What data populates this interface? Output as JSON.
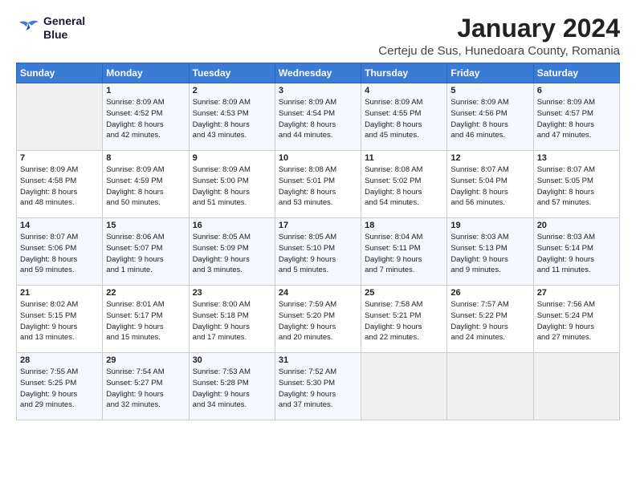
{
  "logo": {
    "line1": "General",
    "line2": "Blue"
  },
  "title": "January 2024",
  "subtitle": "Certeju de Sus, Hunedoara County, Romania",
  "weekdays": [
    "Sunday",
    "Monday",
    "Tuesday",
    "Wednesday",
    "Thursday",
    "Friday",
    "Saturday"
  ],
  "weeks": [
    [
      {
        "day": "",
        "info": ""
      },
      {
        "day": "1",
        "info": "Sunrise: 8:09 AM\nSunset: 4:52 PM\nDaylight: 8 hours\nand 42 minutes."
      },
      {
        "day": "2",
        "info": "Sunrise: 8:09 AM\nSunset: 4:53 PM\nDaylight: 8 hours\nand 43 minutes."
      },
      {
        "day": "3",
        "info": "Sunrise: 8:09 AM\nSunset: 4:54 PM\nDaylight: 8 hours\nand 44 minutes."
      },
      {
        "day": "4",
        "info": "Sunrise: 8:09 AM\nSunset: 4:55 PM\nDaylight: 8 hours\nand 45 minutes."
      },
      {
        "day": "5",
        "info": "Sunrise: 8:09 AM\nSunset: 4:56 PM\nDaylight: 8 hours\nand 46 minutes."
      },
      {
        "day": "6",
        "info": "Sunrise: 8:09 AM\nSunset: 4:57 PM\nDaylight: 8 hours\nand 47 minutes."
      }
    ],
    [
      {
        "day": "7",
        "info": "Sunrise: 8:09 AM\nSunset: 4:58 PM\nDaylight: 8 hours\nand 48 minutes."
      },
      {
        "day": "8",
        "info": "Sunrise: 8:09 AM\nSunset: 4:59 PM\nDaylight: 8 hours\nand 50 minutes."
      },
      {
        "day": "9",
        "info": "Sunrise: 8:09 AM\nSunset: 5:00 PM\nDaylight: 8 hours\nand 51 minutes."
      },
      {
        "day": "10",
        "info": "Sunrise: 8:08 AM\nSunset: 5:01 PM\nDaylight: 8 hours\nand 53 minutes."
      },
      {
        "day": "11",
        "info": "Sunrise: 8:08 AM\nSunset: 5:02 PM\nDaylight: 8 hours\nand 54 minutes."
      },
      {
        "day": "12",
        "info": "Sunrise: 8:07 AM\nSunset: 5:04 PM\nDaylight: 8 hours\nand 56 minutes."
      },
      {
        "day": "13",
        "info": "Sunrise: 8:07 AM\nSunset: 5:05 PM\nDaylight: 8 hours\nand 57 minutes."
      }
    ],
    [
      {
        "day": "14",
        "info": "Sunrise: 8:07 AM\nSunset: 5:06 PM\nDaylight: 8 hours\nand 59 minutes."
      },
      {
        "day": "15",
        "info": "Sunrise: 8:06 AM\nSunset: 5:07 PM\nDaylight: 9 hours\nand 1 minute."
      },
      {
        "day": "16",
        "info": "Sunrise: 8:05 AM\nSunset: 5:09 PM\nDaylight: 9 hours\nand 3 minutes."
      },
      {
        "day": "17",
        "info": "Sunrise: 8:05 AM\nSunset: 5:10 PM\nDaylight: 9 hours\nand 5 minutes."
      },
      {
        "day": "18",
        "info": "Sunrise: 8:04 AM\nSunset: 5:11 PM\nDaylight: 9 hours\nand 7 minutes."
      },
      {
        "day": "19",
        "info": "Sunrise: 8:03 AM\nSunset: 5:13 PM\nDaylight: 9 hours\nand 9 minutes."
      },
      {
        "day": "20",
        "info": "Sunrise: 8:03 AM\nSunset: 5:14 PM\nDaylight: 9 hours\nand 11 minutes."
      }
    ],
    [
      {
        "day": "21",
        "info": "Sunrise: 8:02 AM\nSunset: 5:15 PM\nDaylight: 9 hours\nand 13 minutes."
      },
      {
        "day": "22",
        "info": "Sunrise: 8:01 AM\nSunset: 5:17 PM\nDaylight: 9 hours\nand 15 minutes."
      },
      {
        "day": "23",
        "info": "Sunrise: 8:00 AM\nSunset: 5:18 PM\nDaylight: 9 hours\nand 17 minutes."
      },
      {
        "day": "24",
        "info": "Sunrise: 7:59 AM\nSunset: 5:20 PM\nDaylight: 9 hours\nand 20 minutes."
      },
      {
        "day": "25",
        "info": "Sunrise: 7:58 AM\nSunset: 5:21 PM\nDaylight: 9 hours\nand 22 minutes."
      },
      {
        "day": "26",
        "info": "Sunrise: 7:57 AM\nSunset: 5:22 PM\nDaylight: 9 hours\nand 24 minutes."
      },
      {
        "day": "27",
        "info": "Sunrise: 7:56 AM\nSunset: 5:24 PM\nDaylight: 9 hours\nand 27 minutes."
      }
    ],
    [
      {
        "day": "28",
        "info": "Sunrise: 7:55 AM\nSunset: 5:25 PM\nDaylight: 9 hours\nand 29 minutes."
      },
      {
        "day": "29",
        "info": "Sunrise: 7:54 AM\nSunset: 5:27 PM\nDaylight: 9 hours\nand 32 minutes."
      },
      {
        "day": "30",
        "info": "Sunrise: 7:53 AM\nSunset: 5:28 PM\nDaylight: 9 hours\nand 34 minutes."
      },
      {
        "day": "31",
        "info": "Sunrise: 7:52 AM\nSunset: 5:30 PM\nDaylight: 9 hours\nand 37 minutes."
      },
      {
        "day": "",
        "info": ""
      },
      {
        "day": "",
        "info": ""
      },
      {
        "day": "",
        "info": ""
      }
    ]
  ]
}
